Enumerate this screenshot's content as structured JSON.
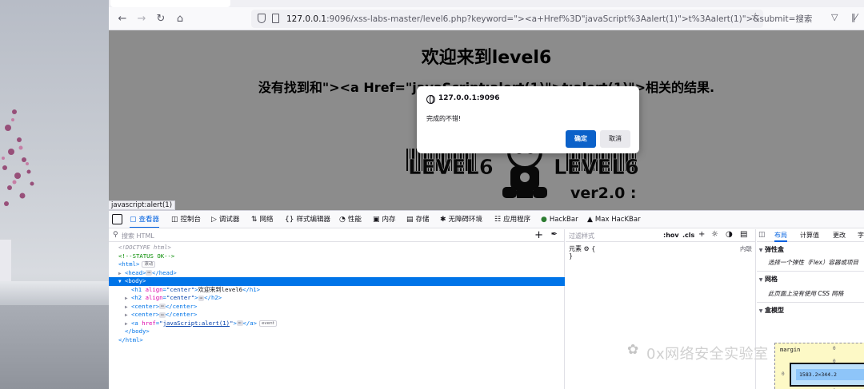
{
  "browser": {
    "url_host": "127.0.0.1",
    "url_rest": ":9096/xss-labs-master/level6.php?keyword=\"><a+Href%3D\"javaScript%3Aalert(1)\">t%3Aalert(1)\">&submit=搜索",
    "nav_icons": [
      "back-icon",
      "forward-icon",
      "reload-icon",
      "home-icon"
    ]
  },
  "page": {
    "heading": "欢迎来到level6",
    "subheading": "没有找到和\"><a Href=\"javaScript:alert(1)\">t:alert(1)\">相关的结果.",
    "logo_text_left": "LEVEL6",
    "logo_text_right": "LEVEL6",
    "logo_version": "ver2.0 :",
    "status_link": "javascript:alert(1)"
  },
  "dialog": {
    "origin": "127.0.0.1:9096",
    "message": "完成的不错!",
    "ok_label": "确定",
    "cancel_label": "取消"
  },
  "devtools": {
    "tabs": [
      {
        "icon": "inspector-icon",
        "label": "查看器"
      },
      {
        "icon": "console-icon",
        "label": "控制台"
      },
      {
        "icon": "debugger-icon",
        "label": "调试器"
      },
      {
        "icon": "network-icon",
        "label": "网络"
      },
      {
        "icon": "style-editor-icon",
        "label": "样式编辑器"
      },
      {
        "icon": "performance-icon",
        "label": "性能"
      },
      {
        "icon": "memory-icon",
        "label": "内存"
      },
      {
        "icon": "storage-icon",
        "label": "存储"
      },
      {
        "icon": "accessibility-icon",
        "label": "无障碍环境"
      },
      {
        "icon": "application-icon",
        "label": "应用程序"
      },
      {
        "icon": "hackbar-icon",
        "label": "HackBar"
      },
      {
        "icon": "max-hackbar-icon",
        "label": "Max HacKBar"
      }
    ],
    "search_placeholder": "搜索 HTML",
    "markup": {
      "doctype": "<!DOCTYPE html>",
      "comment": "<!--STATUS OK-->",
      "html_open": "<html>",
      "scroll_badge": "滚动",
      "head": "<head>",
      "head_close": "</head>",
      "body_open": "<body>",
      "h1_text": "欢迎来到level6",
      "center": "center",
      "href_val": "javaScript:alert(1)",
      "event_badge": "event",
      "body_close": "</body>",
      "html_close": "</html>"
    },
    "rules": {
      "filter_placeholder": "过滤样式",
      "hov": ":hov",
      "cls": ".cls",
      "element_label": "元素",
      "inline_label": "内联",
      "brace_open": "{",
      "brace_close": "}"
    },
    "layout": {
      "tabs": [
        "布局",
        "计算值",
        "更改",
        "字"
      ],
      "flex_title": "弹性盒",
      "flex_body": "选择一个弹性（Flex）容器或项目",
      "grid_title": "网格",
      "grid_body": "此页面上没有使用 CSS 网格",
      "boxmodel_title": "盒模型",
      "margin_label": "margin",
      "content_size": "1583.2×344.2",
      "zero": "0"
    }
  },
  "watermark": "0x网络安全实验室"
}
